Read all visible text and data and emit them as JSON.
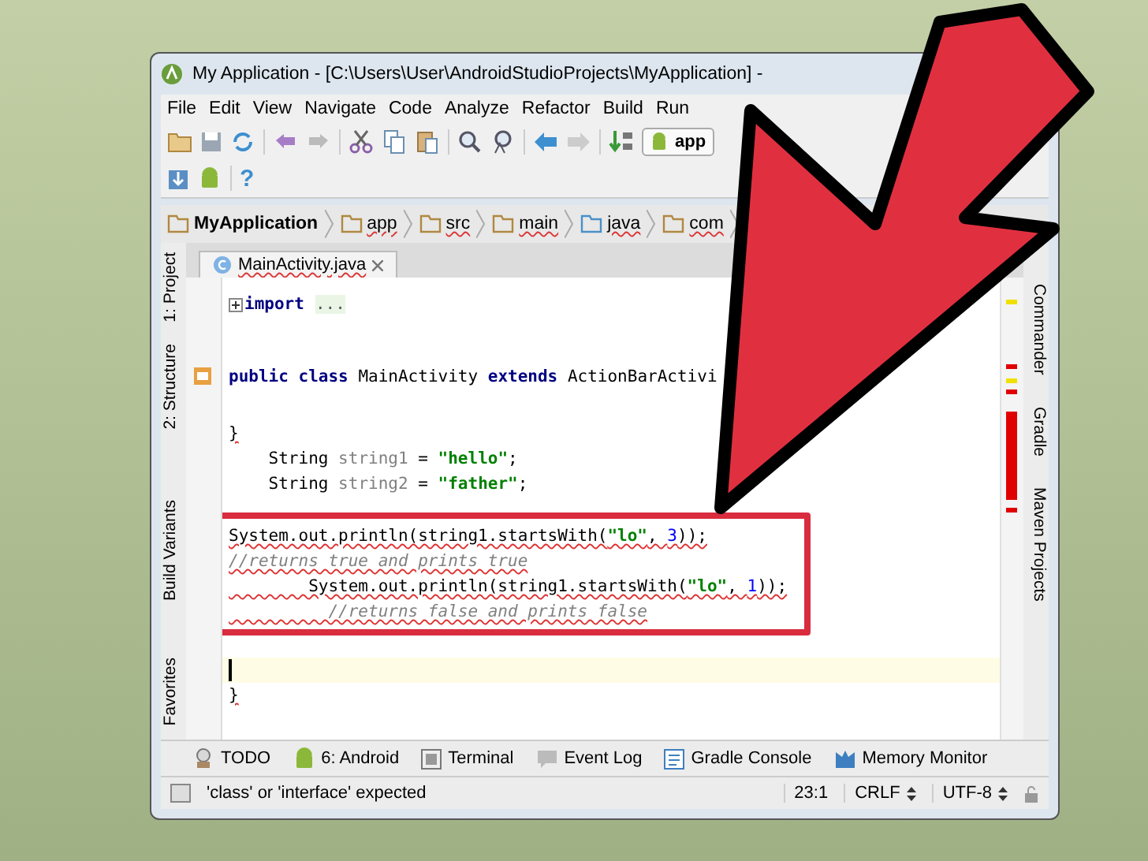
{
  "window": {
    "title": "My Application - [C:\\Users\\User\\AndroidStudioProjects\\MyApplication] -"
  },
  "menu": [
    "File",
    "Edit",
    "View",
    "Navigate",
    "Code",
    "Analyze",
    "Refactor",
    "Build",
    "Run"
  ],
  "toolbar": {
    "run_config": "app",
    "help": "?"
  },
  "breadcrumbs": [
    "MyApplication",
    "app",
    "src",
    "main",
    "java",
    "com"
  ],
  "tabs": [
    {
      "label": "MainActivity.java",
      "selected": true
    }
  ],
  "left_tools": [
    "1: Project",
    "2: Structure",
    "Build Variants",
    "Favorites"
  ],
  "right_tools": [
    "Commander",
    "Gradle",
    "Maven Projects"
  ],
  "code_blocks": [
    {
      "highlighted": false,
      "lines": [
        {
          "kind": "folded",
          "error": false,
          "segments": [
            {
              "kind": "keyword",
              "text": "import"
            },
            {
              "kind": "folded",
              "text": "..."
            }
          ]
        }
      ]
    },
    {
      "highlighted": false,
      "lines": [
        {
          "kind": "code",
          "error": false,
          "segments": [
            {
              "kind": "keyword",
              "text": "public class "
            },
            {
              "kind": "plain",
              "text": "MainActivity "
            },
            {
              "kind": "keyword",
              "text": "extends "
            },
            {
              "kind": "plain",
              "text": "ActionBarActivi"
            }
          ]
        }
      ]
    },
    {
      "highlighted": false,
      "lines": [
        {
          "kind": "code",
          "error": true,
          "segments": [
            {
              "kind": "plain",
              "text": "}"
            }
          ]
        },
        {
          "kind": "code",
          "error": false,
          "segments": [
            {
              "kind": "plain",
              "text": "    String "
            },
            {
              "kind": "unused",
              "text": "string1"
            },
            {
              "kind": "plain",
              "text": " = "
            },
            {
              "kind": "string",
              "text": "\"hello\""
            },
            {
              "kind": "plain",
              "text": ";"
            }
          ]
        },
        {
          "kind": "code",
          "error": false,
          "segments": [
            {
              "kind": "plain",
              "text": "    String "
            },
            {
              "kind": "unused",
              "text": "string2"
            },
            {
              "kind": "plain",
              "text": " = "
            },
            {
              "kind": "string",
              "text": "\"father\""
            },
            {
              "kind": "plain",
              "text": ";"
            }
          ]
        }
      ]
    },
    {
      "highlighted": true,
      "lines": [
        {
          "kind": "code",
          "error": true,
          "segments": [
            {
              "kind": "plain",
              "text": "System.out.println(string1.startsWith("
            },
            {
              "kind": "string",
              "text": "\"lo\""
            },
            {
              "kind": "plain",
              "text": ", "
            },
            {
              "kind": "number",
              "text": "3"
            },
            {
              "kind": "plain",
              "text": "));"
            }
          ]
        },
        {
          "kind": "code",
          "error": true,
          "segments": [
            {
              "kind": "comment",
              "text": "//returns true and prints true"
            }
          ]
        },
        {
          "kind": "code",
          "error": true,
          "segments": [
            {
              "kind": "plain",
              "text": "        System.out.println(string1.startsWith("
            },
            {
              "kind": "string",
              "text": "\"lo\""
            },
            {
              "kind": "plain",
              "text": ", "
            },
            {
              "kind": "number",
              "text": "1"
            },
            {
              "kind": "plain",
              "text": "));"
            }
          ]
        },
        {
          "kind": "code",
          "error": true,
          "segments": [
            {
              "kind": "comment",
              "text": "          //returns false and prints false"
            }
          ]
        }
      ]
    },
    {
      "highlighted": false,
      "lines": [
        {
          "kind": "cursor"
        },
        {
          "kind": "code",
          "error": true,
          "segments": [
            {
              "kind": "plain",
              "text": "}"
            }
          ]
        }
      ]
    }
  ],
  "bottom_tools": [
    {
      "kind": "todo",
      "label": "TODO"
    },
    {
      "kind": "android",
      "label": "6: Android"
    },
    {
      "kind": "terminal",
      "label": "Terminal"
    },
    {
      "kind": "log",
      "label": "Event Log"
    },
    {
      "kind": "console",
      "label": "Gradle Console"
    },
    {
      "kind": "monitor",
      "label": "Memory Monitor"
    }
  ],
  "status_bar": {
    "message": "'class' or 'interface' expected",
    "position": "23:1",
    "line_separator": "CRLF",
    "encoding": "UTF-8"
  }
}
